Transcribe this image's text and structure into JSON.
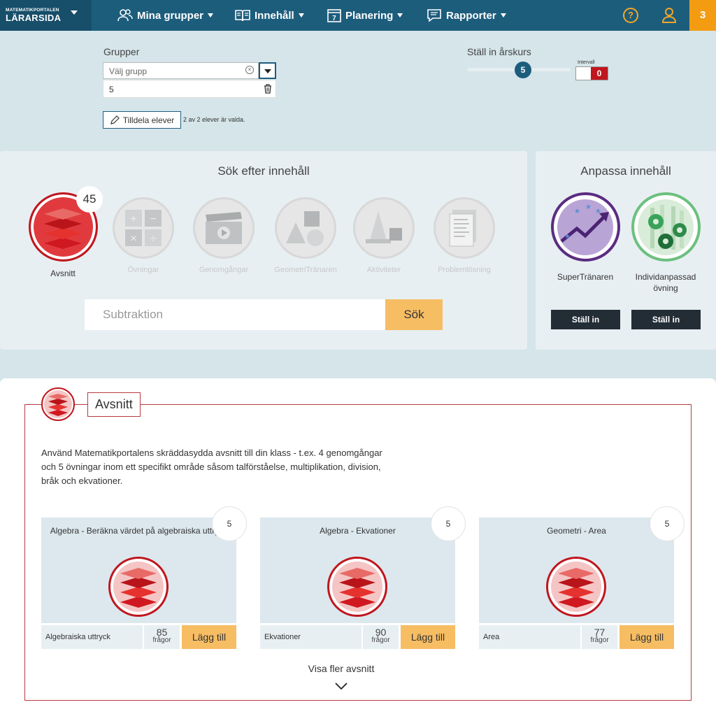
{
  "nav": {
    "brand_small": "MATEMATIKPORTALEN",
    "brand_big": "LÄRARSIDA",
    "items": [
      {
        "label": "Mina grupper"
      },
      {
        "label": "Innehåll"
      },
      {
        "label": "Planering"
      },
      {
        "label": "Rapporter"
      }
    ],
    "help": "?",
    "notification_count": "3",
    "icons": [
      "users-icon",
      "book-icon",
      "calendar-icon",
      "chat-icon",
      "help-icon",
      "user-icon"
    ]
  },
  "groups": {
    "label": "Grupper",
    "select_placeholder": "Välj grupp",
    "selected_row": "5",
    "assign_button": "Tilldela elever",
    "assign_note": "2 av 2 elever är valda."
  },
  "grade": {
    "label": "Ställ in årskurs",
    "value": "5",
    "interval_label": "Intervall",
    "interval_state": "0"
  },
  "search": {
    "title": "Sök efter innehåll",
    "categories": [
      {
        "label": "Avsnitt",
        "count": "45",
        "active": true
      },
      {
        "label": "Övningar"
      },
      {
        "label": "Genomgångar"
      },
      {
        "label": "GeometriTränaren"
      },
      {
        "label": "Aktiviteter"
      },
      {
        "label": "Problemlösning"
      }
    ],
    "input_value": "Subtraktion",
    "button": "Sök"
  },
  "adapt": {
    "title": "Anpassa innehåll",
    "items": [
      {
        "label_line1": "SuperTränaren",
        "label_line2": "",
        "button": "Ställ in"
      },
      {
        "label_line1": "Individanpassad",
        "label_line2": "övning",
        "button": "Ställ in"
      }
    ]
  },
  "section": {
    "title": "Avsnitt",
    "description": "Använd Matematikportalens skräddasydda avsnitt till din klass - t.ex. 4 genomgångar och 5 övningar inom ett specifikt område såsom talförståelse, multiplikation, division, bråk och ekvationer.",
    "cards": [
      {
        "title": "Algebra - Beräkna värdet på algebraiska uttryck",
        "count": "5",
        "tag": "Algebraiska uttryck",
        "questions": "85",
        "questions_unit": "frågor",
        "add": "Lägg till"
      },
      {
        "title": "Algebra - Ekvationer",
        "count": "5",
        "tag": "Ekvationer",
        "questions": "90",
        "questions_unit": "frågor",
        "add": "Lägg till"
      },
      {
        "title": "Geometri - Area",
        "count": "5",
        "tag": "Area",
        "questions": "77",
        "questions_unit": "frågor",
        "add": "Lägg till"
      }
    ],
    "show_more": "Visa fler avsnitt"
  },
  "colors": {
    "nav_bg": "#1d5d7c",
    "accent_orange": "#f39c12",
    "button_orange": "#f7bd63",
    "red": "#c0161e",
    "purple": "#5b2d82",
    "green": "#2e9b4a"
  }
}
